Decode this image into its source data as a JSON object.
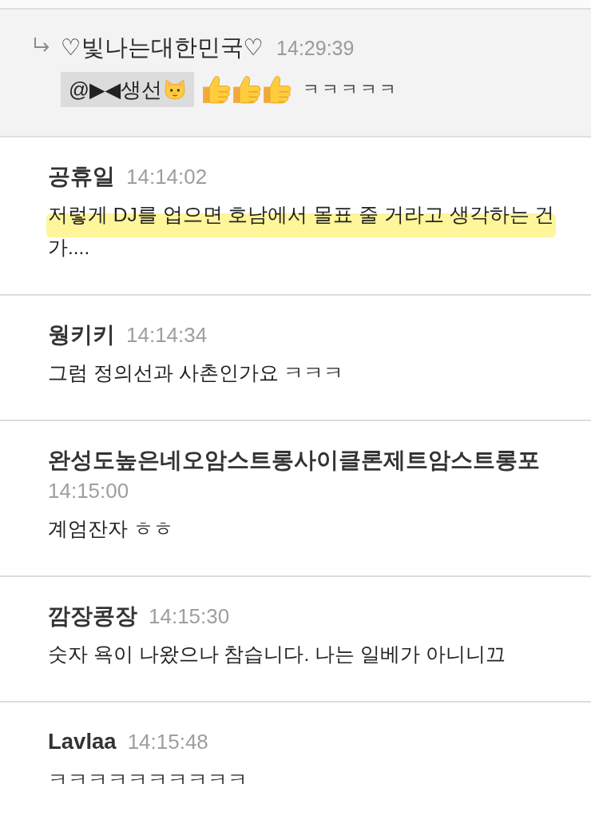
{
  "reply": {
    "author": "♡빛나는대한민국♡",
    "time": "14:29:39",
    "content": [
      {
        "kind": "mention",
        "text": "@▶◀생선",
        "emoji": true
      },
      {
        "kind": "emoji"
      },
      {
        "kind": "emoji"
      },
      {
        "kind": "emoji"
      },
      {
        "kind": "text",
        "text": "ㅋㅋㅋㅋㅋ"
      }
    ]
  },
  "comments": [
    {
      "author": "공휴일",
      "time": "14:14:02",
      "text": "저렇게 DJ를 업으면 호남에서 몰표 줄 거라고 생각하는 건가....",
      "highlighted": true
    },
    {
      "author": "웡키키",
      "time": "14:14:34",
      "text": "그럼 정의선과 사촌인가요 ㅋㅋㅋ",
      "highlighted": false
    },
    {
      "author": "완성도높은네오암스트롱사이클론제트암스트롱포",
      "time": "14:15:00",
      "text": "계엄잔자 ㅎㅎ",
      "highlighted": false
    },
    {
      "author": "깜장콩장",
      "time": "14:15:30",
      "text": "숫자 욕이 나왔으나 참습니다. 나는 일베가 아니니끄",
      "highlighted": false
    },
    {
      "author": "Lavlaa",
      "time": "14:15:48",
      "text": "ㅋㅋㅋㅋㅋㅋㅋㅋㅋㅋ",
      "highlighted": false
    }
  ]
}
